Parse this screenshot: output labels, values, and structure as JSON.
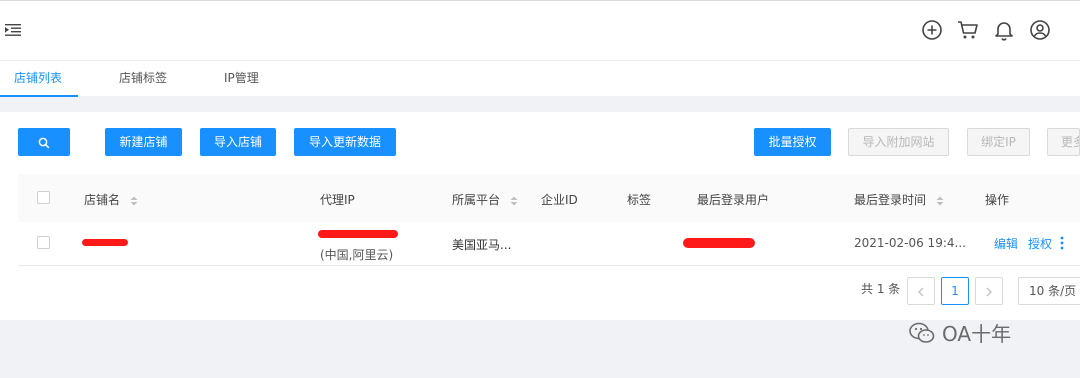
{
  "header": {
    "icons": [
      "menu-fold-icon",
      "plus-circle-icon",
      "cart-icon",
      "bell-icon",
      "user-icon"
    ]
  },
  "tabs": [
    {
      "label": "店铺列表",
      "active": true
    },
    {
      "label": "店铺标签",
      "active": false
    },
    {
      "label": "IP管理",
      "active": false
    }
  ],
  "toolbar": {
    "new_store": "新建店铺",
    "import_store": "导入店铺",
    "import_update": "导入更新数据",
    "batch_auth": "批量授权",
    "import_sites": "导入附加网站",
    "bind_ip": "绑定IP",
    "more": "更多"
  },
  "table": {
    "columns": {
      "store_name": "店铺名",
      "proxy_ip": "代理IP",
      "platform": "所属平台",
      "enterprise_id": "企业ID",
      "tag": "标签",
      "last_user": "最后登录用户",
      "last_login_time": "最后登录时间",
      "actions": "操作"
    },
    "rows": [
      {
        "proxy_ip_location": "(中国,阿里云)",
        "platform": "美国亚马...",
        "last_login_time": "2021-02-06 19:4...",
        "edit": "编辑",
        "authorize": "授权"
      }
    ]
  },
  "pagination": {
    "total": "共 1 条",
    "current_page": "1",
    "page_size": "10 条/页"
  },
  "watermark": "OA十年",
  "colors": {
    "primary": "#1890ff",
    "redaction": "#ff1a1a"
  }
}
